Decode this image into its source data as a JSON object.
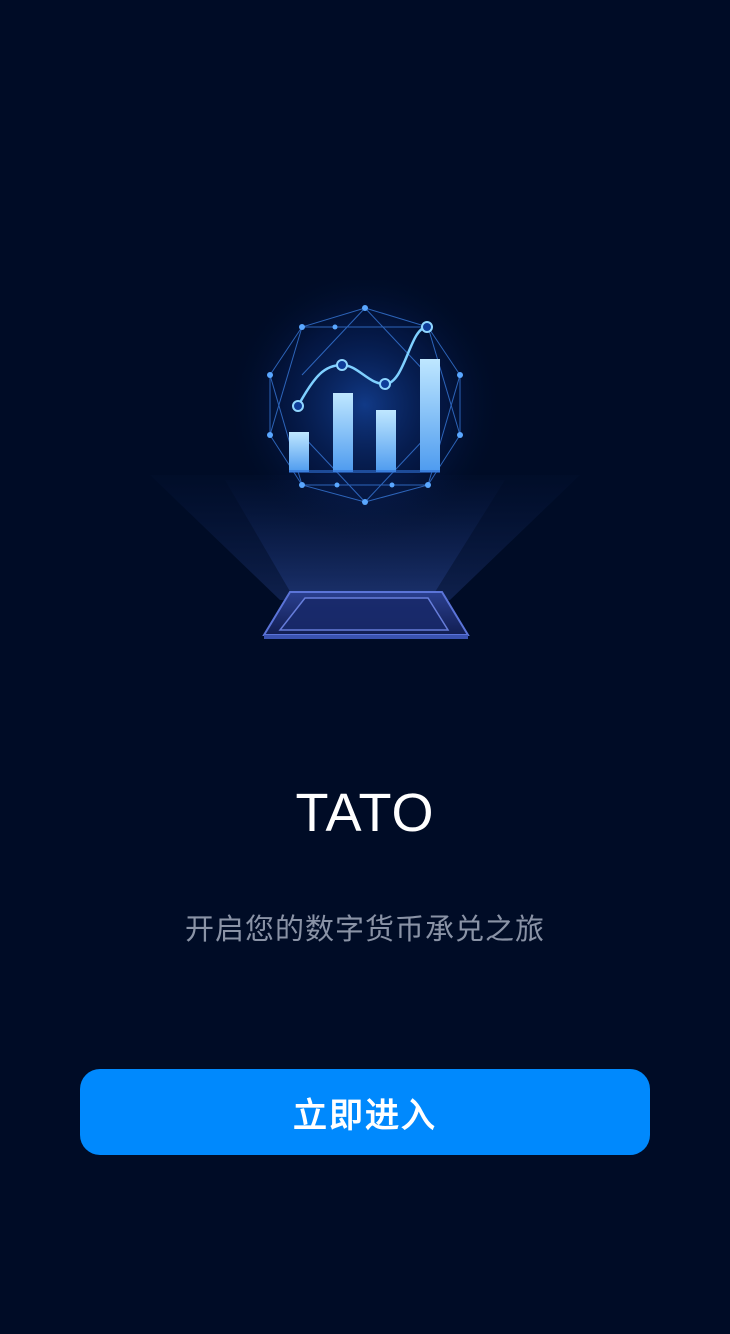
{
  "app": {
    "title": "TATO",
    "tagline": "开启您的数字货币承兑之旅"
  },
  "actions": {
    "enter_label": "立即进入"
  },
  "hero": {
    "icon": "hologram-bar-chart-illustration"
  },
  "colors": {
    "background": "#000c26",
    "accent": "#0089fd",
    "title": "#ffffff",
    "tagline": "#8a93a6"
  }
}
